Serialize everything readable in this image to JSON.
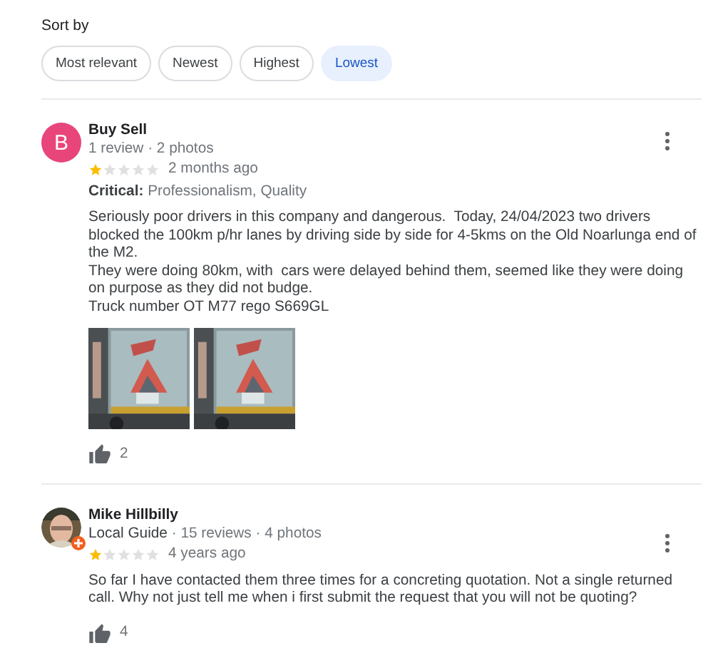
{
  "sort": {
    "label": "Sort by",
    "options": [
      {
        "label": "Most relevant",
        "selected": false
      },
      {
        "label": "Newest",
        "selected": false
      },
      {
        "label": "Highest",
        "selected": false
      },
      {
        "label": "Lowest",
        "selected": true
      }
    ]
  },
  "reviews": [
    {
      "name": "Buy Sell",
      "avatar": {
        "kind": "letter",
        "letter": "B",
        "color": "#e8457a"
      },
      "meta": "1 review · 2 photos",
      "stars": 1,
      "time": "2 months ago",
      "critical": {
        "label": "Critical:",
        "value": "Professionalism, Quality"
      },
      "body": "Seriously poor drivers in this company and dangerous.  Today, 24/04/2023 two drivers blocked the 100km p/hr lanes by driving side by side for 4-5kms on the Old Noarlunga end of the M2.\nThey were doing 80km, with  cars were delayed behind them, seemed like they were doing on purpose as they did not budge.\nTruck number OT M77 rego S669GL",
      "photos": [
        {
          "kind": "picture"
        },
        {
          "kind": "picture"
        }
      ],
      "likes": "2"
    },
    {
      "name": "Mike Hillbilly",
      "avatar": {
        "kind": "picture"
      },
      "local_guide": "Local Guide",
      "meta": " · 15 reviews · 4 photos",
      "stars": 1,
      "time": "4 years ago",
      "body": "So far I have contacted them three times for a concreting quotation. Not a single returned call. Why not just tell me when i first submit the request that you will not be quoting?",
      "likes": "4"
    }
  ]
}
